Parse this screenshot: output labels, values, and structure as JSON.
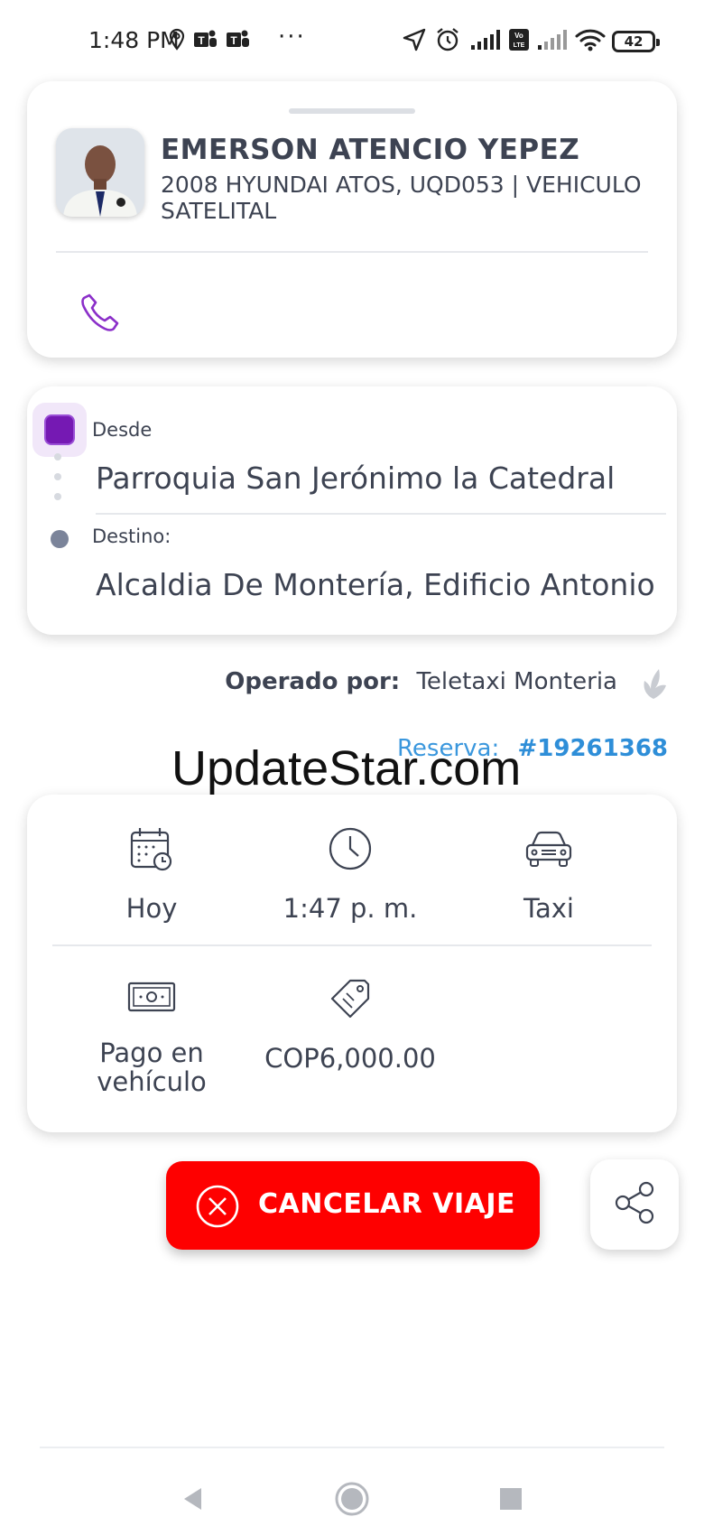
{
  "status_bar": {
    "time": "1:48 PM",
    "battery": "42",
    "icons": [
      "location-pin-icon",
      "teams-icon",
      "teams-icon",
      "more-dots-icon",
      "navigation-arrow-icon",
      "alarm-icon",
      "signal-icon",
      "volte-icon",
      "signal-weak-icon",
      "wifi-icon",
      "battery-icon"
    ],
    "more": "···"
  },
  "driver": {
    "name": "EMERSON ATENCIO YEPEZ",
    "vehicle": "2008 HYUNDAI ATOS, UQD053 | VEHICULO SATELITAL",
    "avatar_icon": "driver-photo",
    "call_icon": "phone-icon"
  },
  "route": {
    "from_label": "Desde",
    "from_place": "Parroquia San Jerónimo la Catedral",
    "to_label": "Destino:",
    "to_place": "Alcaldia De Montería, Edificio Antonio"
  },
  "operator": {
    "label": "Operado por:",
    "name": "Teletaxi Monteria",
    "icon": "leaf-logo-icon"
  },
  "reservation": {
    "label": "Reserva:",
    "number": "#19261368"
  },
  "watermark": "UpdateStar.com",
  "trip_info": {
    "date": "Hoy",
    "time": "1:47 p. m.",
    "vehicle_type": "Taxi",
    "payment": "Pago en vehículo",
    "price": "COP6,000.00",
    "icons": [
      "calendar-icon",
      "clock-icon",
      "car-icon",
      "cash-icon",
      "price-tag-icon"
    ]
  },
  "actions": {
    "cancel_label": "CANCELAR VIAJE",
    "share_icon": "share-icon"
  },
  "colors": {
    "accent_purple": "#7519b3",
    "cancel_red": "#fe0000",
    "link_blue": "#2e8ed8",
    "text": "#3d4352"
  },
  "nav_bar": [
    "back-icon",
    "home-icon",
    "recents-icon"
  ]
}
